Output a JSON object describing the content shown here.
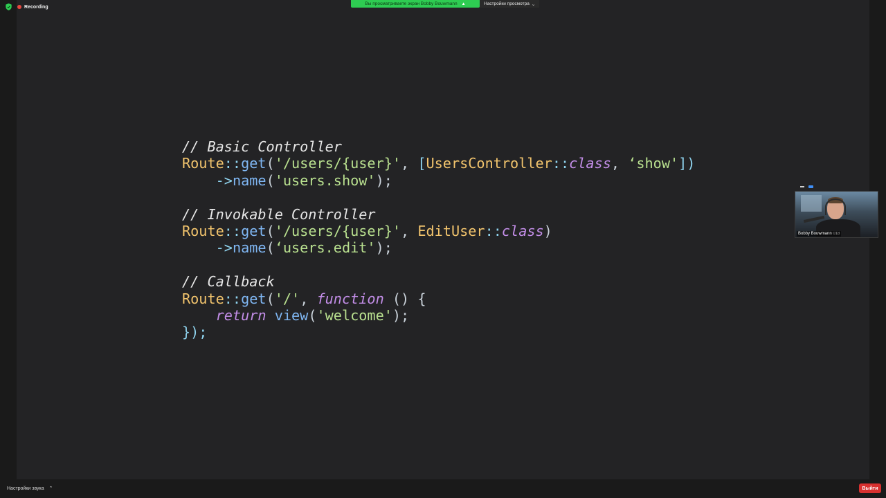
{
  "recording": {
    "label": "Recording"
  },
  "share_banner": {
    "text": "Вы просматриваете экран Bobby Bouwmann"
  },
  "view_settings": {
    "label": "Настройки просмотра",
    "caret": "⌄"
  },
  "code": {
    "lines": [
      [
        {
          "t": "cm",
          "v": "// Basic Controller"
        }
      ],
      [
        {
          "t": "cls",
          "v": "Route"
        },
        {
          "t": "op",
          "v": "::"
        },
        {
          "t": "fn",
          "v": "get"
        },
        {
          "t": "pl",
          "v": "("
        },
        {
          "t": "str",
          "v": "'/users/{user}'"
        },
        {
          "t": "pl",
          "v": ", "
        },
        {
          "t": "op",
          "v": "["
        },
        {
          "t": "cls",
          "v": "UsersController"
        },
        {
          "t": "op",
          "v": "::"
        },
        {
          "t": "kw",
          "v": "class"
        },
        {
          "t": "pl",
          "v": ", "
        },
        {
          "t": "str",
          "v": "‘show'"
        },
        {
          "t": "op",
          "v": "])"
        }
      ],
      [
        {
          "t": "pl",
          "v": "    "
        },
        {
          "t": "op",
          "v": "->"
        },
        {
          "t": "fn",
          "v": "name"
        },
        {
          "t": "pl",
          "v": "("
        },
        {
          "t": "str",
          "v": "'users.show'"
        },
        {
          "t": "pl",
          "v": ");"
        }
      ],
      [
        {
          "t": "pl",
          "v": ""
        }
      ],
      [
        {
          "t": "cm",
          "v": "// Invokable Controller"
        }
      ],
      [
        {
          "t": "cls",
          "v": "Route"
        },
        {
          "t": "op",
          "v": "::"
        },
        {
          "t": "fn",
          "v": "get"
        },
        {
          "t": "pl",
          "v": "("
        },
        {
          "t": "str",
          "v": "'/users/{user}'"
        },
        {
          "t": "pl",
          "v": ", "
        },
        {
          "t": "cls",
          "v": "EditUser"
        },
        {
          "t": "op",
          "v": "::"
        },
        {
          "t": "kw",
          "v": "class"
        },
        {
          "t": "pl",
          "v": ")"
        }
      ],
      [
        {
          "t": "pl",
          "v": "    "
        },
        {
          "t": "op",
          "v": "->"
        },
        {
          "t": "fn",
          "v": "name"
        },
        {
          "t": "pl",
          "v": "("
        },
        {
          "t": "str",
          "v": "‘users.edit'"
        },
        {
          "t": "pl",
          "v": ");"
        }
      ],
      [
        {
          "t": "pl",
          "v": ""
        }
      ],
      [
        {
          "t": "cm",
          "v": "// Callback"
        }
      ],
      [
        {
          "t": "cls",
          "v": "Route"
        },
        {
          "t": "op",
          "v": "::"
        },
        {
          "t": "fn",
          "v": "get"
        },
        {
          "t": "pl",
          "v": "("
        },
        {
          "t": "str",
          "v": "'/'"
        },
        {
          "t": "pl",
          "v": ", "
        },
        {
          "t": "kw",
          "v": "function"
        },
        {
          "t": "pl",
          "v": " () {"
        }
      ],
      [
        {
          "t": "pl",
          "v": "    "
        },
        {
          "t": "kw",
          "v": "return"
        },
        {
          "t": "pl",
          "v": " "
        },
        {
          "t": "fn",
          "v": "view"
        },
        {
          "t": "pl",
          "v": "("
        },
        {
          "t": "str",
          "v": "'welcome'"
        },
        {
          "t": "pl",
          "v": ");"
        }
      ],
      [
        {
          "t": "op",
          "v": "});"
        }
      ]
    ]
  },
  "participant": {
    "name": "Bobby Bouwmann",
    "badge": "018"
  },
  "bottom": {
    "audio_settings": "Настройки звука",
    "caret": "⌃",
    "leave_label": "Выйти"
  },
  "colors": {
    "banner": "#2ecc52",
    "leave": "#d8302f",
    "recording": "#e8473f"
  }
}
